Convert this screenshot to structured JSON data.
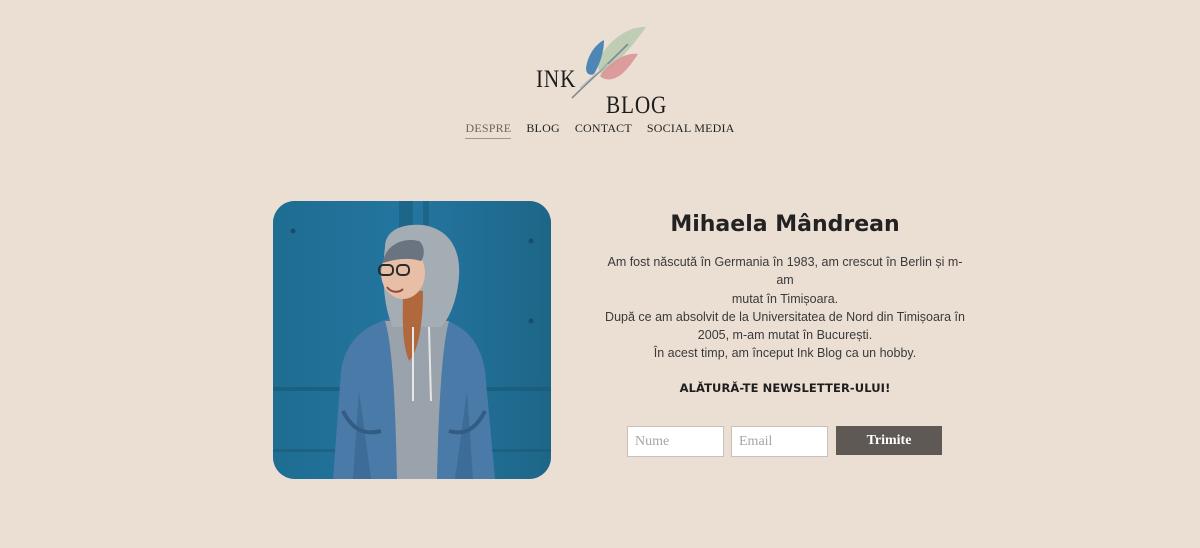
{
  "logo": {
    "line1": "INK",
    "line2": "BLOG",
    "icon": "feather-icon",
    "colors": {
      "blue": "#4f86b5",
      "red": "#d48a8a",
      "green": "#b9cbb0"
    }
  },
  "nav": {
    "items": [
      {
        "label": "DESPRE",
        "active": true
      },
      {
        "label": "BLOG"
      },
      {
        "label": "CONTACT"
      },
      {
        "label": "SOCIAL MEDIA"
      }
    ]
  },
  "profile": {
    "name": "Mihaela Mândrean",
    "bio": [
      "Am fost născută în Germania în 1983, am crescut în Berlin și m-am",
      "mutat în Timișoara.",
      "După ce am absolvit de la Universitatea de Nord din Timișoara în",
      "2005, m-am mutat în București.",
      "În acest timp, am început Ink Blog ca un hobby."
    ]
  },
  "newsletter": {
    "title": "ALĂTURĂ-TE NEWSLETTER-ULUI!",
    "name_placeholder": "Nume",
    "email_placeholder": "Email",
    "submit_label": "Trimite"
  },
  "colors": {
    "background": "#ebdfd3",
    "button": "#5f5955"
  }
}
